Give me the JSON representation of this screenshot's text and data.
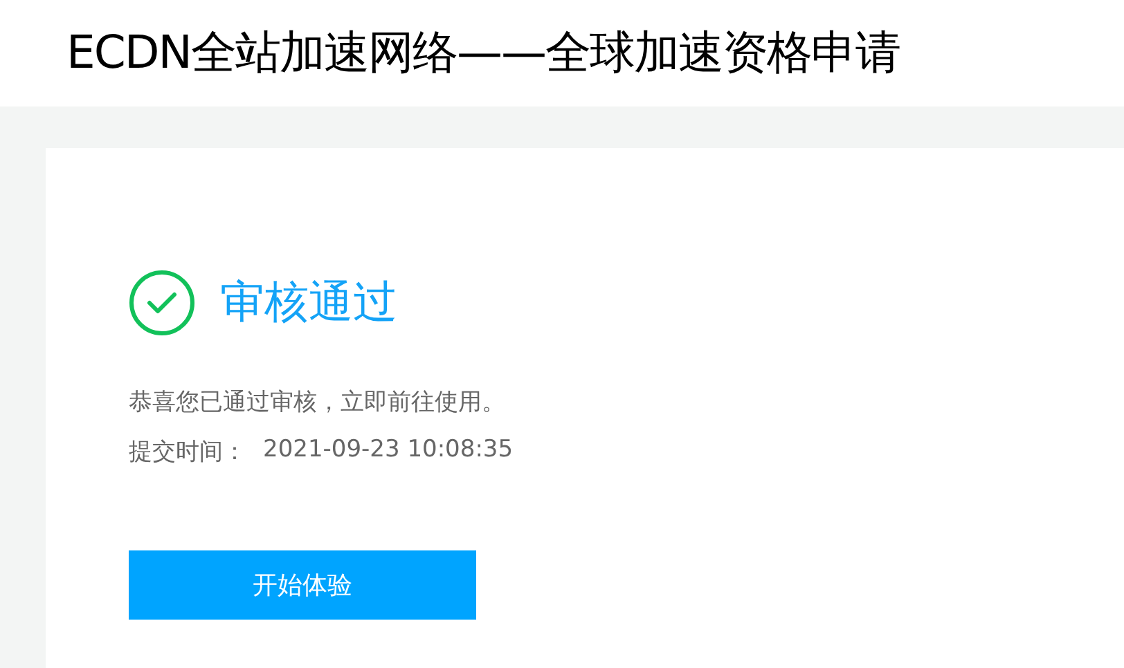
{
  "page_title": "ECDN全站加速网络——全球加速资格申请",
  "result": {
    "kind": "success",
    "heading": "审核通过",
    "message": "恭喜您已通过审核，立即前往使用。",
    "submit_label": "提交时间：",
    "submit_time": "2021-09-23 10:08:35"
  },
  "button": "开始体验"
}
